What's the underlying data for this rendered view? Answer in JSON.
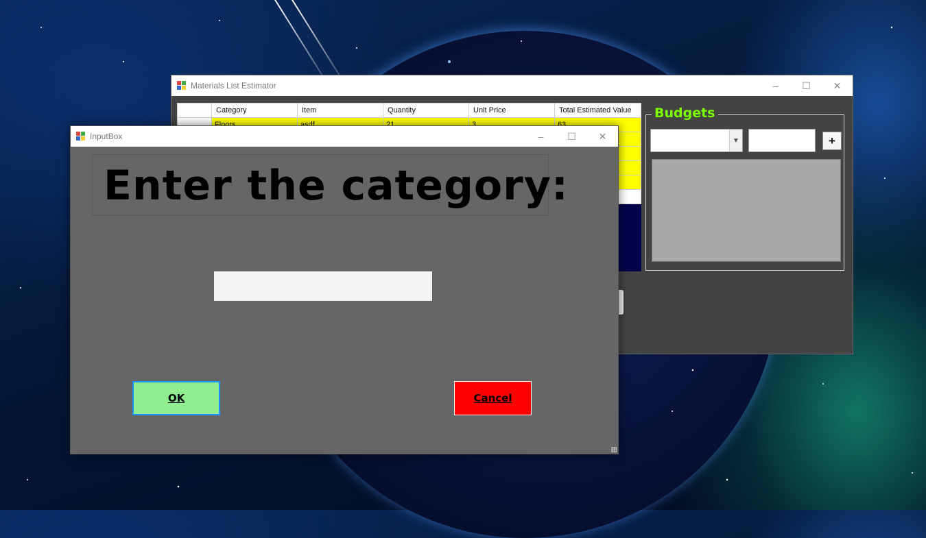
{
  "main_window": {
    "title": "Materials List Estimator",
    "grid": {
      "columns": [
        "",
        "Category",
        "Item",
        "Quantity",
        "Unit Price",
        "Total Estimated Value"
      ],
      "rows": [
        [
          "",
          "Floors",
          "asdf",
          "21",
          "3",
          "63"
        ]
      ]
    },
    "budgets": {
      "title": "Budgets",
      "add_label": "+"
    }
  },
  "dialog": {
    "title": "InputBox",
    "prompt": "Enter the category:",
    "input_value": "",
    "ok_label": "OK",
    "cancel_label": "Cancel"
  },
  "window_controls": {
    "minimize": "–",
    "maximize": "☐",
    "close": "✕"
  },
  "colors": {
    "grid_row": "#ffff00",
    "budgets_title": "#7cfc00",
    "ok_button": "#90ee90",
    "cancel_button": "#ff0000",
    "dialog_bg": "#666666"
  }
}
